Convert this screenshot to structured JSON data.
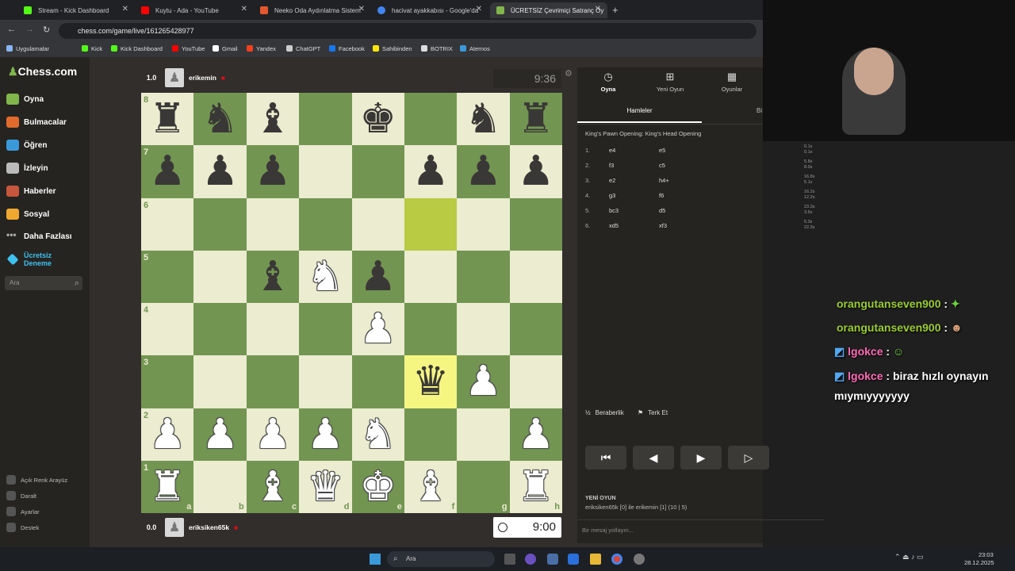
{
  "browser": {
    "tabs": [
      {
        "title": "Stream - Kick Dashboard",
        "color": "#53fc18"
      },
      {
        "title": "Kuytu - Ada - YouTube",
        "color": "#ff0000"
      },
      {
        "title": "Neeko Oda Aydınlatma Sistem",
        "color": "#e4572e"
      },
      {
        "title": "hacivat ayakkabısı - Google'da",
        "color": "#4285f4"
      },
      {
        "title": "ÜCRETSİZ Çevrimiçi Satranç Oy",
        "color": "#81b64c"
      }
    ],
    "url": "chess.com/game/live/161265428977",
    "bookmarks": [
      "Uygulamalar",
      "Kick",
      "Kick Dashboard",
      "YouTube",
      "Gmail",
      "Yandex",
      "ChatGPT",
      "Facebook",
      "Sahibinden",
      "BOTRIX",
      "Aternos"
    ]
  },
  "sidebar": {
    "logo": "Chess.com",
    "items": [
      {
        "label": "Oyna",
        "icon": "pawn-icon",
        "color": "#81b64c"
      },
      {
        "label": "Bulmacalar",
        "icon": "puzzle-icon",
        "color": "#e06b2c"
      },
      {
        "label": "Öğren",
        "icon": "learn-icon",
        "color": "#3a9ad9"
      },
      {
        "label": "İzleyin",
        "icon": "binoculars-icon",
        "color": "#bbbbbb"
      },
      {
        "label": "Haberler",
        "icon": "news-icon",
        "color": "#c8553d"
      },
      {
        "label": "Sosyal",
        "icon": "social-icon",
        "color": "#f0a830"
      },
      {
        "label": "Daha Fazlası",
        "icon": "more-icon",
        "color": "#aaaaaa"
      },
      {
        "label": "Ücretsiz Deneme",
        "icon": "diamond-icon",
        "color": "#3ec1f0"
      }
    ],
    "search_placeholder": "Ara",
    "footer": [
      "Açık Renk Arayüz",
      "Daralt",
      "Ayarlar",
      "Destek"
    ]
  },
  "game": {
    "top_player": {
      "eval": "1.0",
      "name": "erikemin",
      "clock": "9:36"
    },
    "bottom_player": {
      "eval": "0.0",
      "name": "eriksiken65k",
      "clock": "9:00"
    },
    "ranks": [
      "8",
      "7",
      "6",
      "5",
      "4",
      "3",
      "2",
      "1"
    ],
    "files": [
      "a",
      "b",
      "c",
      "d",
      "e",
      "f",
      "g",
      "h"
    ],
    "board": [
      [
        "br",
        "bn",
        "bb",
        "",
        "bk",
        "",
        "bn",
        "br"
      ],
      [
        "bp",
        "bp",
        "bp",
        "",
        "",
        "bp",
        "bp",
        "bp"
      ],
      [
        "",
        "",
        "",
        "",
        "",
        "",
        "",
        ""
      ],
      [
        "",
        "",
        "bb",
        "wn",
        "bp",
        "",
        "",
        ""
      ],
      [
        "",
        "",
        "",
        "",
        "wp",
        "",
        "",
        ""
      ],
      [
        "",
        "",
        "",
        "",
        "",
        "bq",
        "wp",
        ""
      ],
      [
        "wp",
        "wp",
        "wp",
        "wp",
        "wn",
        "",
        "",
        "wp"
      ],
      [
        "wr",
        "",
        "wb",
        "wq",
        "wk",
        "wb",
        "",
        "wr"
      ]
    ],
    "highlights": [
      "f6",
      "f3"
    ]
  },
  "panel": {
    "tabs": [
      "Oyna",
      "Yeni Oyun",
      "Oyunlar"
    ],
    "subtabs": [
      "Hamleler",
      "Bi"
    ],
    "opening": "King's Pawn Opening: King's Head Opening",
    "moves": [
      {
        "n": "1.",
        "w": "e4",
        "b": "e5",
        "t1": "0.1s",
        "t2": "0.1s"
      },
      {
        "n": "2.",
        "w": "f3",
        "b": "c5",
        "t1": "5.8s",
        "t2": "8.0s"
      },
      {
        "n": "3.",
        "w": "e2",
        "b": "h4+",
        "t1": "16.8s",
        "t2": "5.1s"
      },
      {
        "n": "4.",
        "w": "g3",
        "b": "f6",
        "t1": "16.2s",
        "t2": "12.2s"
      },
      {
        "n": "5.",
        "w": "bc3",
        "b": "d5",
        "t1": "23.3s",
        "t2": "3.6s"
      },
      {
        "n": "6.",
        "w": "xd5",
        "b": "xf3",
        "t1": "5.3s",
        "t2": "22.3s"
      }
    ],
    "draw_label": "Beraberlik",
    "resign_label": "Terk Et",
    "new_game_title": "YENİ OYUN",
    "new_game_text": "eriksiken65k [0] ile erikemin [1] (10 | 5)",
    "message_placeholder": "Bir mesaj yollayın..."
  },
  "chat": [
    {
      "user": "orangutanseven900",
      "text": "",
      "color": "#9acd32"
    },
    {
      "user": "orangutanseven900",
      "text": "",
      "color": "#9acd32"
    },
    {
      "user": "lgokce",
      "text": "",
      "color": "#ff69b4"
    },
    {
      "user": "lgokce",
      "text": "biraz hızlı oynayın",
      "color": "#ff69b4"
    },
    {
      "user": "",
      "text": "mıymıyyyyyyy",
      "color": "#ffffff"
    }
  ],
  "taskbar": {
    "search": "Ara",
    "time": "23:03",
    "date": "28.12.2025"
  }
}
